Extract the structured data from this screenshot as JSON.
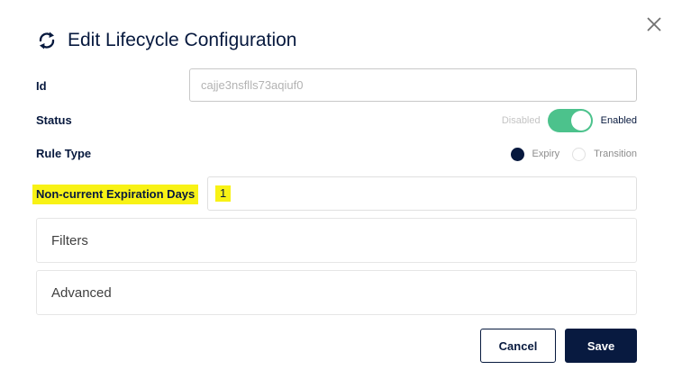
{
  "dialog": {
    "title": "Edit Lifecycle Configuration",
    "icon": "lifecycle-refresh-icon",
    "close_icon": "close-icon"
  },
  "form": {
    "id_label": "Id",
    "id_value": "cajje3nsflls73aqiuf0",
    "status_label": "Status",
    "status_off_label": "Disabled",
    "status_on_label": "Enabled",
    "status_enabled": true,
    "rule_type_label": "Rule Type",
    "rule_type_options": [
      "Expiry",
      "Transition"
    ],
    "rule_type_selected": "Expiry",
    "noncurrent_label": "Non-current Expiration Days",
    "noncurrent_value": "1"
  },
  "sections": {
    "filters": "Filters",
    "advanced": "Advanced"
  },
  "actions": {
    "cancel_label": "Cancel",
    "save_label": "Save"
  },
  "colors": {
    "primary": "#081a40",
    "toggle_on": "#4cc28c",
    "highlight": "#f8f215"
  }
}
